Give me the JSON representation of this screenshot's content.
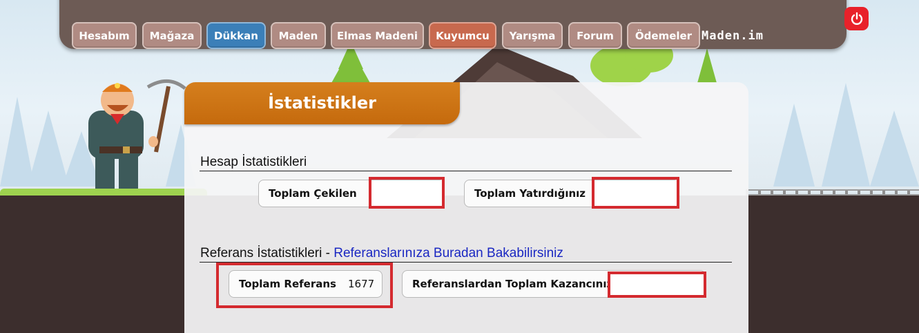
{
  "nav": {
    "items": [
      {
        "label": "Hesabım"
      },
      {
        "label": "Mağaza"
      },
      {
        "label": "Dükkan"
      },
      {
        "label": "Maden"
      },
      {
        "label": "Elmas Madeni"
      },
      {
        "label": "Kuyumcu"
      },
      {
        "label": "Yarışma"
      },
      {
        "label": "Forum"
      },
      {
        "label": "Ödemeler"
      }
    ],
    "active": "Dükkan",
    "logo": "Maden.im",
    "power_icon": "power-icon"
  },
  "panel": {
    "title": "İstatistikler",
    "account_section": {
      "heading": "Hesap İstatistikleri",
      "total_withdrawn_label": "Toplam Çekilen",
      "total_withdrawn_value": "",
      "total_deposited_label": "Toplam Yatırdığınız",
      "total_deposited_value": ""
    },
    "referral_section": {
      "heading": "Referans İstatistikleri",
      "separator": "-",
      "link": "Referanslarınıza Buradan Bakabilirsiniz",
      "total_referrals_label": "Toplam Referans",
      "total_referrals_value": "1677",
      "referral_earnings_label": "Referanslardan Toplam Kazancınız",
      "referral_earnings_value": ""
    }
  },
  "colors": {
    "nav_bg": "#6d5b55",
    "nav_button": "#b08b83",
    "nav_active": "#3b7fb8",
    "nav_special": "#c8694e",
    "header_orange": "#c56a0d",
    "highlight_red": "#d42a2f",
    "link_blue": "#1a27c2"
  }
}
